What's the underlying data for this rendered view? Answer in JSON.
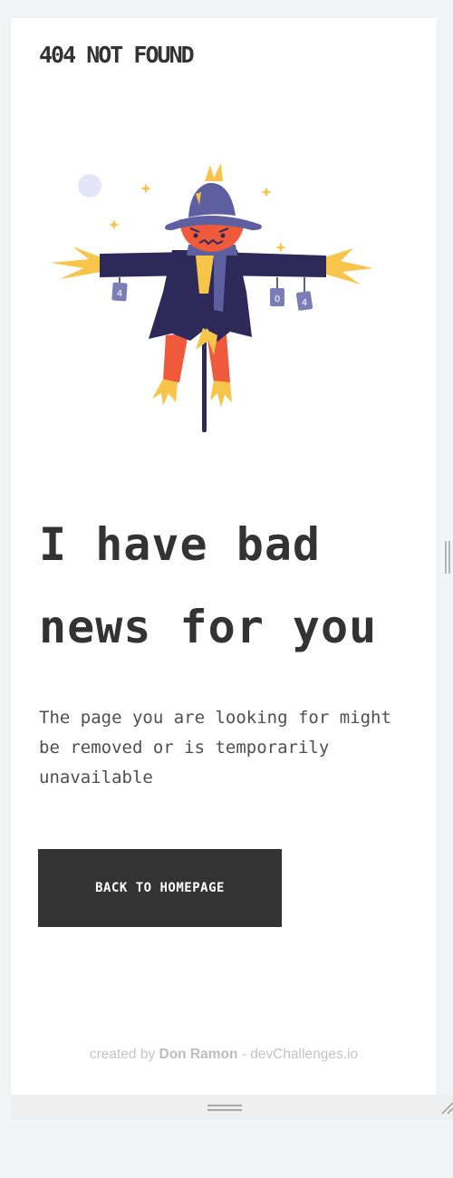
{
  "header": {
    "brand": "404 NOT FOUND"
  },
  "illustration": {
    "icon": "scarecrow-illustration-icon",
    "card_labels": [
      "4",
      "0",
      "4"
    ]
  },
  "main": {
    "headline": "I have bad news for you",
    "message": "The page you are looking for might be removed or is temporarily unavailable",
    "cta_label": "BACK TO HOMEPAGE"
  },
  "footer": {
    "prefix": "created by ",
    "author": "Don Ramon",
    "suffix": " - devChallenges.io"
  },
  "colors": {
    "text": "#333333",
    "body_text": "#4f4f4f",
    "button_bg": "#333333",
    "button_text": "#ffffff",
    "footer_text": "#c4c4c4",
    "hat": "#5d5fa0",
    "coat": "#2d2a59",
    "straw": "#f8c54b",
    "face": "#ee5a3b"
  }
}
